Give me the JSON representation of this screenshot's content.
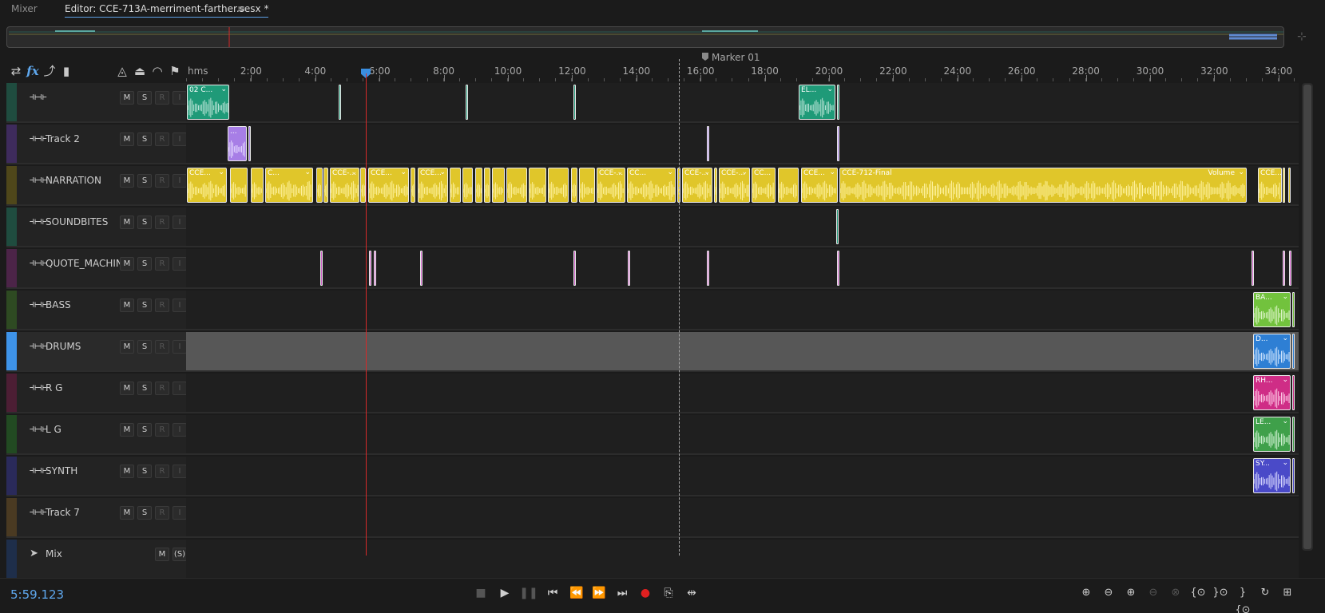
{
  "tabs": {
    "mixer": "Mixer",
    "editor": "Editor: CCE-713A-merriment-farther.sesx *",
    "menu_icon": "≡"
  },
  "ruler": {
    "unit_label": "hms",
    "labels": [
      "2:00",
      "4:00",
      "6:00",
      "8:00",
      "10:00",
      "12:00",
      "14:00",
      "16:00",
      "18:00",
      "20:00",
      "22:00",
      "24:00",
      "26:00",
      "28:00",
      "30:00",
      "32:00",
      "34:00"
    ]
  },
  "marker": {
    "label": "Marker 01"
  },
  "time_display": "5:59.123",
  "tracks": [
    {
      "name": "",
      "color": "#1f4c3f",
      "m": "M",
      "s": "S",
      "r": "R",
      "i": "I"
    },
    {
      "name": "Track 2",
      "color": "#3e2b5c",
      "m": "M",
      "s": "S",
      "r": "R",
      "i": "I"
    },
    {
      "name": "NARRATION",
      "color": "#4f471a",
      "m": "M",
      "s": "S",
      "r": "R",
      "i": "I"
    },
    {
      "name": "SOUNDBITES",
      "color": "#1f4c3f",
      "m": "M",
      "s": "S",
      "r": "R",
      "i": "I"
    },
    {
      "name": "QUOTE_MACHIN",
      "color": "#4c2448",
      "m": "M",
      "s": "S",
      "r": "R",
      "i": "I"
    },
    {
      "name": "BASS",
      "color": "#2e4a22",
      "m": "M",
      "s": "S",
      "r": "R",
      "i": "I"
    },
    {
      "name": "DRUMS",
      "color": "#3e93e8",
      "m": "M",
      "s": "S",
      "r": "R",
      "i": "I"
    },
    {
      "name": "R G",
      "color": "#4c1e34",
      "m": "M",
      "s": "S",
      "r": "R",
      "i": "I"
    },
    {
      "name": "L G",
      "color": "#224a22",
      "m": "M",
      "s": "S",
      "r": "R",
      "i": "I"
    },
    {
      "name": "SYNTH",
      "color": "#2a2a5a",
      "m": "M",
      "s": "S",
      "r": "R",
      "i": "I"
    },
    {
      "name": "Track 7",
      "color": "#4a3a22",
      "m": "M",
      "s": "S",
      "r": "R",
      "i": "I"
    }
  ],
  "mix_track": {
    "name": "Mix",
    "color": "#1e2e4a",
    "m": "M",
    "s": "(S)"
  },
  "clips": {
    "t0_a": "02 C...",
    "t0_b": "EL...",
    "t1_a": "...",
    "narr": [
      "CCE...",
      "C...",
      "CCE-...",
      "CCE...",
      "CCE...",
      "CCE-...",
      "CC...",
      "CCE-...",
      "CCE-...",
      "CC...",
      "CCE...",
      "C...",
      "C..."
    ],
    "narr_final": "CCE-712-Final",
    "narr_volume": "Volume",
    "narr_last": "CCE...",
    "bass": "BA...",
    "drums": "D...",
    "rg": "RH...",
    "lg": "LE...",
    "synth": "SY..."
  },
  "colors": {
    "teal": "#1f9a78",
    "purple": "#a77ee6",
    "yellow": "#e0c62a",
    "pink": "#cf5fc8",
    "green": "#72c23d",
    "blue": "#2e7fd4",
    "magenta": "#cf2d86",
    "lgreen": "#3fa04a",
    "indigo": "#4a4ac8"
  }
}
